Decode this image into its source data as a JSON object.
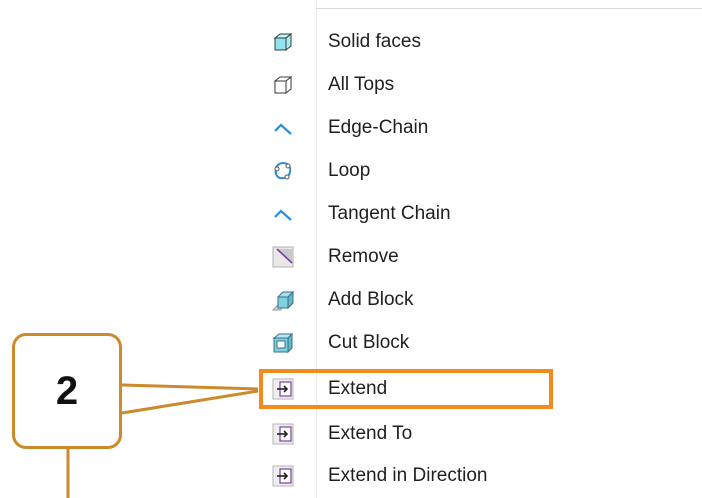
{
  "menu": {
    "items": [
      {
        "label": "Solid faces",
        "icon": "solid-faces-icon"
      },
      {
        "label": "All Tops",
        "icon": "all-tops-icon"
      },
      {
        "label": "Edge-Chain",
        "icon": "edge-chain-icon"
      },
      {
        "label": "Loop",
        "icon": "loop-icon"
      },
      {
        "label": "Tangent Chain",
        "icon": "tangent-chain-icon"
      },
      {
        "label": "Remove",
        "icon": "remove-icon"
      },
      {
        "label": "Add Block",
        "icon": "add-block-icon"
      },
      {
        "label": "Cut Block",
        "icon": "cut-block-icon"
      },
      {
        "label": "Extend",
        "icon": "extend-icon"
      },
      {
        "label": "Extend To",
        "icon": "extend-to-icon"
      },
      {
        "label": "Extend in Direction",
        "icon": "extend-in-direction-icon"
      }
    ],
    "highlighted_item": "Extend"
  },
  "callout": {
    "number": "2",
    "highlight_color": "#f28a1c",
    "box_color": "#cc8a2c"
  }
}
